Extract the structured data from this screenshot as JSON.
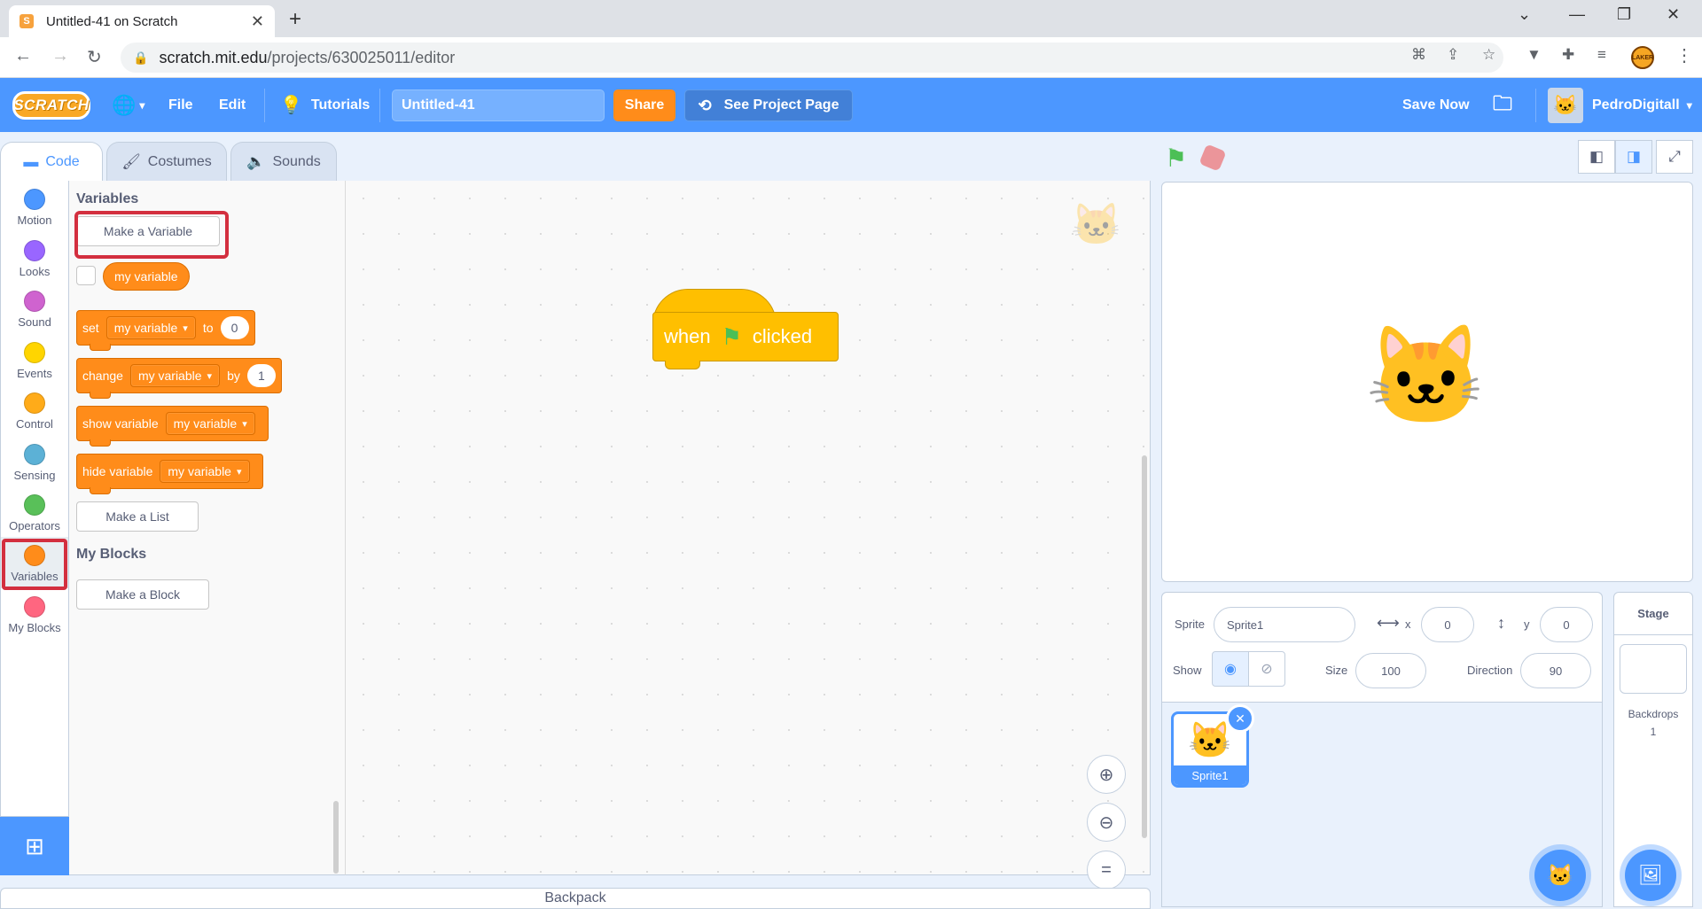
{
  "browser": {
    "tab_title": "Untitled-41 on Scratch",
    "url_host": "scratch.mit.edu",
    "url_path": "/projects/630025011/editor",
    "profile_badge": "LAKER"
  },
  "menubar": {
    "logo": "SCRATCH",
    "file": "File",
    "edit": "Edit",
    "tutorials": "Tutorials",
    "project_title": "Untitled-41",
    "share": "Share",
    "see_project_page": "See Project Page",
    "save_now": "Save Now",
    "username": "PedroDigitall"
  },
  "editor_tabs": {
    "code": "Code",
    "costumes": "Costumes",
    "sounds": "Sounds"
  },
  "categories": [
    {
      "label": "Motion",
      "color": "#4c97ff"
    },
    {
      "label": "Looks",
      "color": "#9966ff"
    },
    {
      "label": "Sound",
      "color": "#cf63cf"
    },
    {
      "label": "Events",
      "color": "#ffd500"
    },
    {
      "label": "Control",
      "color": "#ffab19"
    },
    {
      "label": "Sensing",
      "color": "#5cb1d6"
    },
    {
      "label": "Operators",
      "color": "#59c059"
    },
    {
      "label": "Variables",
      "color": "#ff8c1a"
    },
    {
      "label": "My Blocks",
      "color": "#ff6680"
    }
  ],
  "selected_category": "Variables",
  "palette": {
    "variables_heading": "Variables",
    "make_variable": "Make a Variable",
    "reporter": "my variable",
    "set_block": {
      "verb": "set",
      "var": "my variable",
      "to": "to",
      "value": "0"
    },
    "change_block": {
      "verb": "change",
      "var": "my variable",
      "by": "by",
      "value": "1"
    },
    "show_block": {
      "verb": "show variable",
      "var": "my variable"
    },
    "hide_block": {
      "verb": "hide variable",
      "var": "my variable"
    },
    "make_list": "Make a List",
    "myblocks_heading": "My Blocks",
    "make_block": "Make a Block"
  },
  "script": {
    "hat_when": "when",
    "hat_clicked": "clicked"
  },
  "backpack": "Backpack",
  "sprite_info": {
    "sprite_label": "Sprite",
    "sprite_name": "Sprite1",
    "x_label": "x",
    "x_value": "0",
    "y_label": "y",
    "y_value": "0",
    "show_label": "Show",
    "size_label": "Size",
    "size_value": "100",
    "direction_label": "Direction",
    "direction_value": "90"
  },
  "sprites": [
    {
      "name": "Sprite1",
      "selected": true
    }
  ],
  "stage_panel": {
    "title": "Stage",
    "backdrops_label": "Backdrops",
    "backdrops_count": "1"
  },
  "icons": {
    "green_flag": "green-flag-icon",
    "stop": "stop-icon",
    "globe": "globe-icon",
    "tutorials": "lightbulb-icon",
    "folder": "folder-icon"
  },
  "colors": {
    "scratch_blue": "#4c97ff",
    "variables_orange": "#ff8c1a",
    "events_yellow": "#ffbf00",
    "highlight_red": "#d32f3f"
  }
}
